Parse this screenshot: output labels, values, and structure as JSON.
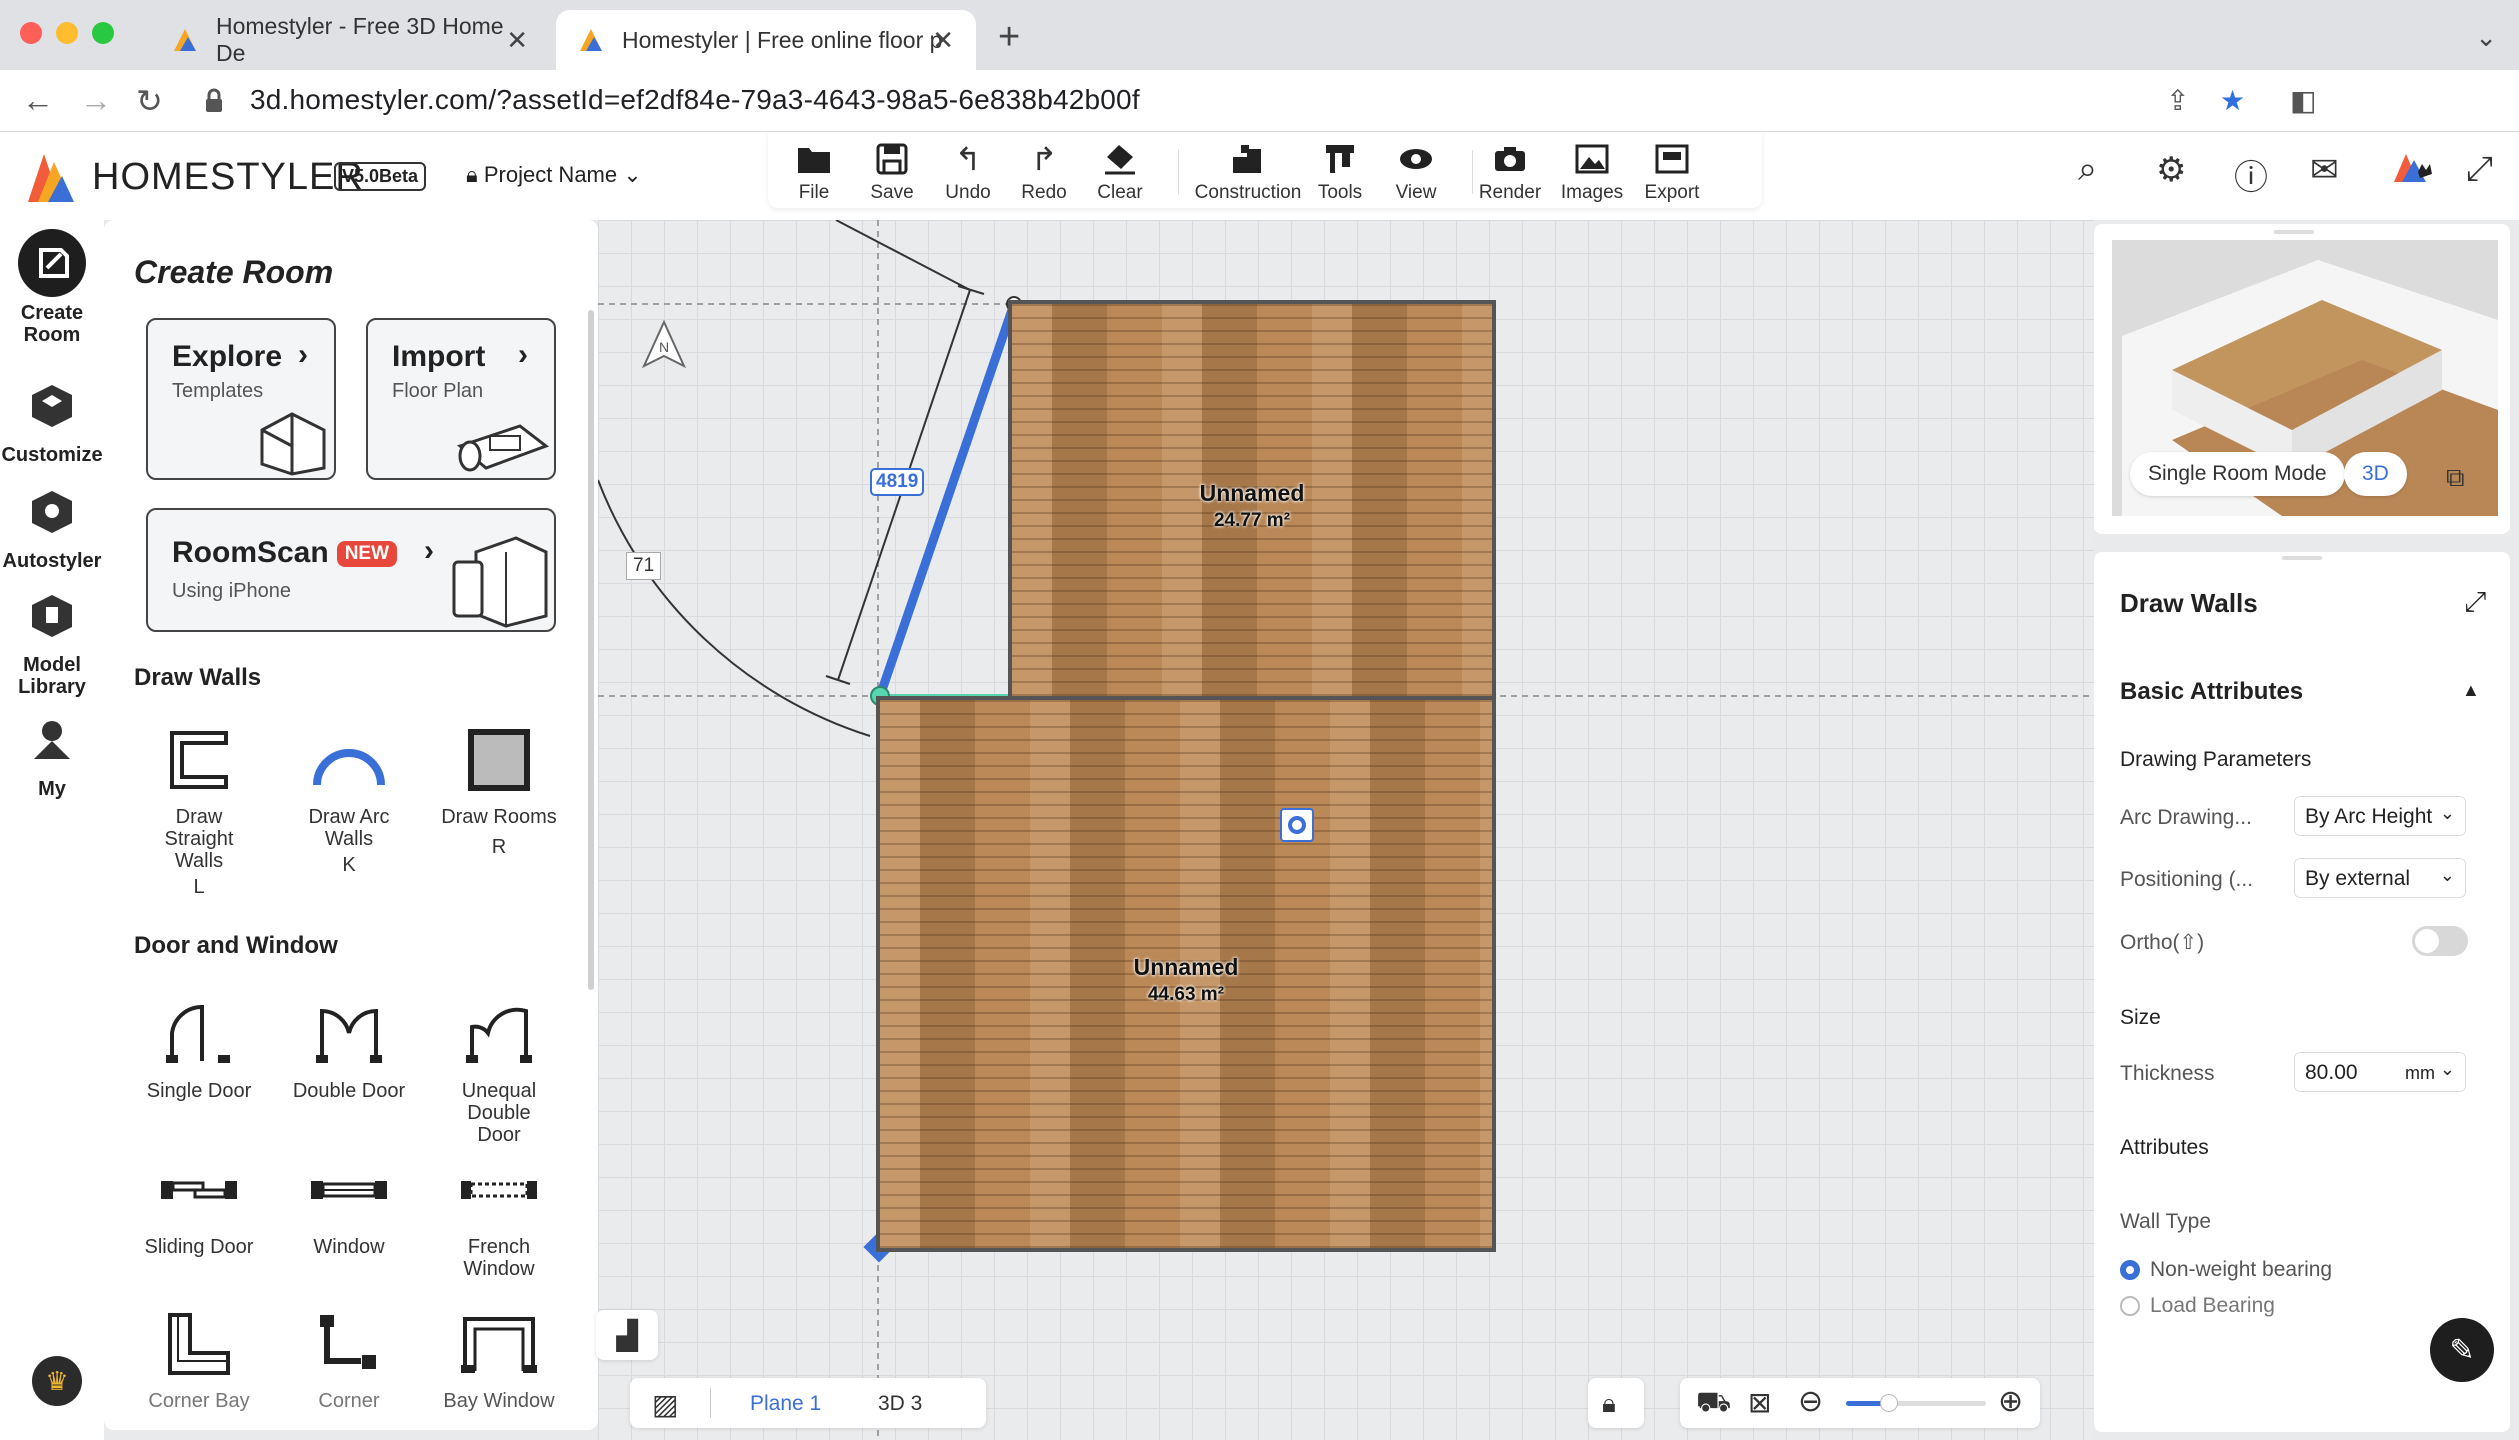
{
  "browser": {
    "tabs": [
      {
        "title": "Homestyler - Free 3D Home De",
        "active": false
      },
      {
        "title": "Homestyler | Free online floor p",
        "active": true
      }
    ],
    "url": "3d.homestyler.com/?assetId=ef2df84e-79a3-4643-98a5-6e838b42b00f"
  },
  "header": {
    "brand": "HOMESTYLER",
    "version": "V5.0Beta",
    "project_name": "Project Name"
  },
  "toolbar": {
    "items": [
      {
        "label": "File",
        "icon": "folder-icon"
      },
      {
        "label": "Save",
        "icon": "save-icon"
      },
      {
        "label": "Undo",
        "icon": "undo-icon"
      },
      {
        "label": "Redo",
        "icon": "redo-icon"
      },
      {
        "label": "Clear",
        "icon": "eraser-icon"
      },
      {
        "label": "Construction",
        "icon": "construction-icon"
      },
      {
        "label": "Tools",
        "icon": "tools-icon"
      },
      {
        "label": "View",
        "icon": "eye-icon"
      },
      {
        "label": "Render",
        "icon": "camera-icon"
      },
      {
        "label": "Images",
        "icon": "image-icon"
      },
      {
        "label": "Export",
        "icon": "export-icon"
      }
    ]
  },
  "rail": {
    "items": [
      {
        "label": "Create Room"
      },
      {
        "label": "Customize"
      },
      {
        "label": "Autostyler"
      },
      {
        "label": "Model Library"
      },
      {
        "label": "My"
      }
    ]
  },
  "panel": {
    "title": "Create Room",
    "explore": {
      "title": "Explore",
      "subtitle": "Templates"
    },
    "import": {
      "title": "Import",
      "subtitle": "Floor Plan"
    },
    "roomscan": {
      "title": "RoomScan",
      "badge": "NEW",
      "subtitle": "Using iPhone"
    },
    "draw_walls_title": "Draw Walls",
    "draw_walls": [
      {
        "label": "Draw Straight Walls",
        "key": "L"
      },
      {
        "label": "Draw Arc Walls",
        "key": "K"
      },
      {
        "label": "Draw Rooms",
        "key": "R"
      }
    ],
    "door_window_title": "Door and Window",
    "doors": [
      {
        "label": "Single Door"
      },
      {
        "label": "Double Door"
      },
      {
        "label": "Unequal Double Door"
      },
      {
        "label": "Sliding Door"
      },
      {
        "label": "Window"
      },
      {
        "label": "French Window"
      },
      {
        "label": "Corner Bay"
      },
      {
        "label": "Corner"
      },
      {
        "label": "Bay Window"
      }
    ]
  },
  "canvas": {
    "compass": "N",
    "dimension_value": "4819",
    "angle_value": "71",
    "rooms": [
      {
        "name": "Unnamed",
        "area": "24.77 m²"
      },
      {
        "name": "Unnamed",
        "area": "44.63 m²"
      }
    ],
    "bottom": {
      "plane": "Plane 1",
      "three_d": "3D 3"
    }
  },
  "preview": {
    "mode_label": "Single Room Mode",
    "view_label": "3D"
  },
  "props": {
    "title": "Draw Walls",
    "basic_attributes": "Basic Attributes",
    "drawing_parameters": "Drawing Parameters",
    "arc_drawing_label": "Arc Drawing...",
    "arc_drawing_value": "By Arc Height",
    "positioning_label": "Positioning (...",
    "positioning_value": "By external",
    "ortho_label": "Ortho(⇧)",
    "size_title": "Size",
    "thickness_label": "Thickness",
    "thickness_value": "80.00",
    "thickness_unit": "mm",
    "attributes_title": "Attributes",
    "wall_type_label": "Wall Type",
    "wall_types": [
      "Non-weight bearing",
      "Load Bearing"
    ]
  },
  "colors": {
    "accent": "#3a6fd8",
    "wall_highlight": "#59d6b0",
    "floor": "#b98756"
  }
}
